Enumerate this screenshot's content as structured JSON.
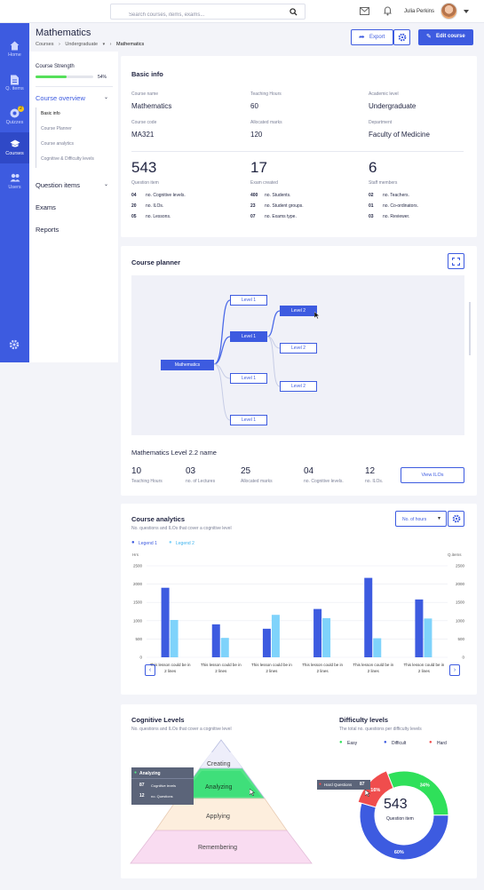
{
  "topbar": {
    "search_placeholder": "Search courses, items, exams...",
    "user_name": "Julia Perkins"
  },
  "sidebar": {
    "items": [
      {
        "label": "Home",
        "icon": "home-icon"
      },
      {
        "label": "Q. items",
        "icon": "document-icon"
      },
      {
        "label": "Quizzes",
        "icon": "puzzle-icon",
        "badge": "2"
      },
      {
        "label": "Courses",
        "icon": "graduation-cap-icon",
        "active": true
      },
      {
        "label": "Users",
        "icon": "users-icon"
      }
    ]
  },
  "header": {
    "title": "Mathematics",
    "breadcrumb": [
      "Courses",
      "Undergraduate",
      "Mathematics"
    ],
    "export_label": "Export",
    "edit_label": "Edit course"
  },
  "left_panel": {
    "strength_label": "Course Strength",
    "strength_value": "54%",
    "strength_fraction": 0.54,
    "overview_label": "Course overview",
    "overview_items": [
      "Basic info",
      "Course Planner",
      "Course analytics",
      "Cognitive & Difficulty levels"
    ],
    "question_items_label": "Question items",
    "exams_label": "Exams",
    "reports_label": "Reports"
  },
  "basic_info": {
    "title": "Basic info",
    "fields": [
      {
        "label": "Course name",
        "value": "Mathematics"
      },
      {
        "label": "Teaching Hours",
        "value": "60"
      },
      {
        "label": "Academic level",
        "value": "Undergraduate"
      },
      {
        "label": "Course code",
        "value": "MA321"
      },
      {
        "label": "Allocated marks",
        "value": "120"
      },
      {
        "label": "Department",
        "value": "Faculty of Medicine"
      }
    ],
    "stats": [
      {
        "value": "543",
        "label": "Question item",
        "rows": [
          [
            "04",
            "no. Cognitive levels."
          ],
          [
            "20",
            "no. ILOs."
          ],
          [
            "05",
            "no. Lessons."
          ]
        ]
      },
      {
        "value": "17",
        "label": "Exam created",
        "rows": [
          [
            "400",
            "no. Students."
          ],
          [
            "23",
            "no. Student groups."
          ],
          [
            "07",
            "no. Exams type."
          ]
        ]
      },
      {
        "value": "6",
        "label": "Staff members",
        "rows": [
          [
            "02",
            "no. Teachers."
          ],
          [
            "01",
            "no. Co-ordinators."
          ],
          [
            "03",
            "no. Reviewer."
          ]
        ]
      }
    ]
  },
  "planner": {
    "title": "Course planner",
    "root": "Mathematics",
    "nodes": [
      "Level 1",
      "Level 1",
      "Level 1",
      "Level 1",
      "Level 2",
      "Level 2",
      "Level 2"
    ],
    "selected_name": "Mathematics Level 2.2 name",
    "stats": [
      {
        "value": "10",
        "label": "Teaching Hours"
      },
      {
        "value": "03",
        "label": "no. of Lectures"
      },
      {
        "value": "25",
        "label": "Allocated marks"
      },
      {
        "value": "04",
        "label": "no. Cognitive levels."
      },
      {
        "value": "12",
        "label": "no. ILOs."
      }
    ],
    "view_ilos_label": "View ILOs"
  },
  "analytics": {
    "title": "Course analytics",
    "subtitle": "No. questions and ILOs that cover a cognitive level",
    "dropdown": "No. of hours",
    "legend": [
      {
        "name": "Legend 1",
        "color": "#3d5be0"
      },
      {
        "name": "Legend 2",
        "color": "#7fd3fb"
      }
    ]
  },
  "chart_data": {
    "type": "bar",
    "left_axis_label": "Hrs",
    "right_axis_label": "Q.items",
    "ylim": [
      0,
      2500
    ],
    "ticks": [
      0,
      500,
      1000,
      1500,
      2000,
      2500
    ],
    "categories": [
      "This lesson could be in 2 lines",
      "This lesson could be in 2 lines",
      "This lesson could be in 2 lines",
      "This lesson could be in 2 lines",
      "This lesson could be in 2 lines",
      "This lesson could be in 2 lines"
    ],
    "series": [
      {
        "name": "Legend 1",
        "values": [
          1900,
          900,
          780,
          1320,
          2170,
          1580
        ]
      },
      {
        "name": "Legend 2",
        "values": [
          1020,
          530,
          1160,
          1070,
          520,
          1060
        ]
      }
    ],
    "grid": true,
    "legend_position": "top-left"
  },
  "cognitive": {
    "title": "Cognitive Levels",
    "subtitle": "No. questions and ILOs that cover a cognitive level",
    "levels": [
      "Creating",
      "Analyzing",
      "Applying",
      "Remembering"
    ],
    "tooltip": {
      "title": "Analyzing",
      "rows": [
        [
          "87",
          "Cognitive levels"
        ],
        [
          "12",
          "no. Questions"
        ]
      ]
    }
  },
  "difficulty": {
    "title": "Difficulty levels",
    "subtitle": "The total no. questions per difficulty levels",
    "legend": [
      {
        "name": "Easy",
        "color": "#2fe05a"
      },
      {
        "name": "Difficult",
        "color": "#3d5be0"
      },
      {
        "name": "Hard",
        "color": "#f04d4d"
      }
    ],
    "slices": [
      {
        "name": "Easy",
        "percent": 34,
        "label": "34%",
        "color": "#2fe05a"
      },
      {
        "name": "Difficult",
        "percent": 60,
        "label": "60%",
        "color": "#3d5be0"
      },
      {
        "name": "Hard",
        "percent": 16,
        "label": "16%",
        "color": "#f04d4d"
      }
    ],
    "center_value": "543",
    "center_label": "Question item",
    "tooltip": {
      "label": "Hard Questions",
      "value": "87"
    }
  }
}
